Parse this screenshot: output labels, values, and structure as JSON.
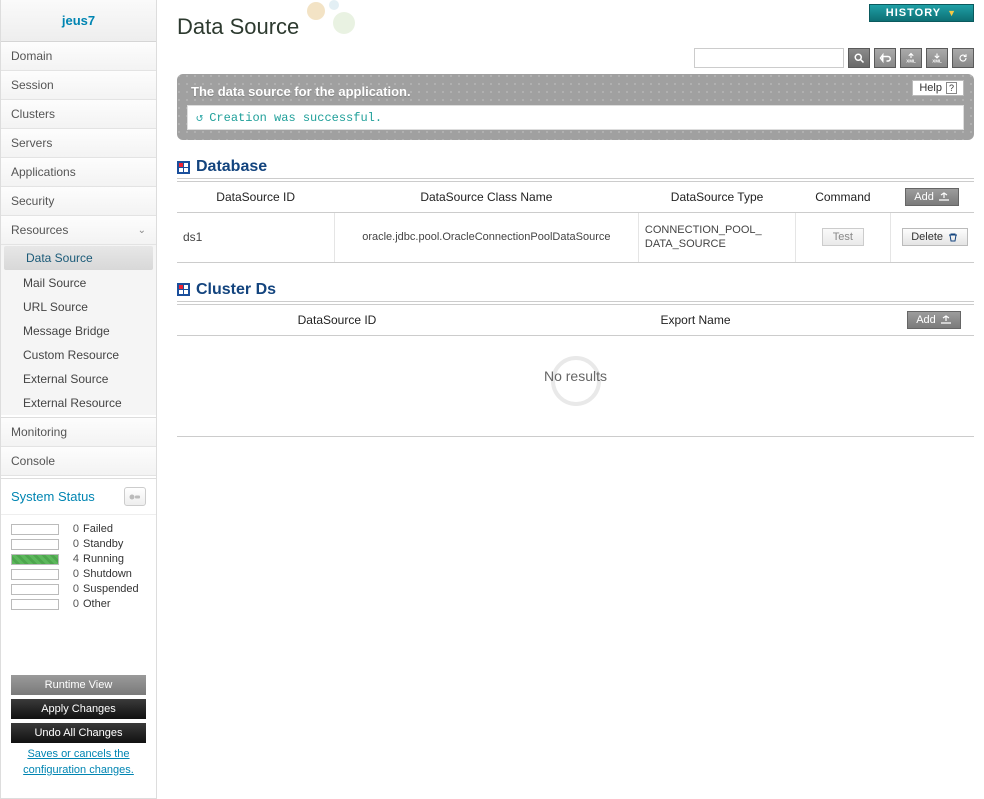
{
  "logo": "jeus7",
  "history_label": "HISTORY",
  "nav": {
    "domain": "Domain",
    "session": "Session",
    "clusters": "Clusters",
    "servers": "Servers",
    "applications": "Applications",
    "security": "Security",
    "resources": "Resources",
    "monitoring": "Monitoring",
    "console": "Console"
  },
  "subnav": {
    "data_source": "Data Source",
    "mail_source": "Mail Source",
    "url_source": "URL Source",
    "message_bridge": "Message Bridge",
    "custom_resource": "Custom Resource",
    "external_source": "External Source",
    "external_resource": "External Resource"
  },
  "system_status": {
    "title": "System Status",
    "rows": [
      {
        "count": "0",
        "label": "Failed",
        "pct": 0
      },
      {
        "count": "0",
        "label": "Standby",
        "pct": 0
      },
      {
        "count": "4",
        "label": "Running",
        "pct": 100
      },
      {
        "count": "0",
        "label": "Shutdown",
        "pct": 0
      },
      {
        "count": "0",
        "label": "Suspended",
        "pct": 0
      },
      {
        "count": "0",
        "label": "Other",
        "pct": 0
      }
    ]
  },
  "buttons": {
    "runtime_view": "Runtime View",
    "apply_changes": "Apply Changes",
    "undo_all": "Undo All Changes",
    "save_note": "Saves or cancels the configuration changes."
  },
  "page": {
    "title": "Data Source",
    "banner_title": "The data source for the application.",
    "help": "Help",
    "message": "Creation was successful.",
    "search_placeholder": ""
  },
  "database": {
    "heading": "Database",
    "headers": {
      "id": "DataSource ID",
      "class": "DataSource Class Name",
      "type": "DataSource Type",
      "command": "Command"
    },
    "add": "Add",
    "rows": [
      {
        "id": "ds1",
        "class": "oracle.jdbc.pool.OracleConnectionPoolDataSource",
        "type": "CONNECTION_POOL_DATA_SOURCE",
        "command": "Test",
        "delete": "Delete"
      }
    ]
  },
  "cluster_ds": {
    "heading": "Cluster Ds",
    "headers": {
      "id": "DataSource ID",
      "export": "Export Name"
    },
    "add": "Add",
    "no_results": "No results"
  }
}
